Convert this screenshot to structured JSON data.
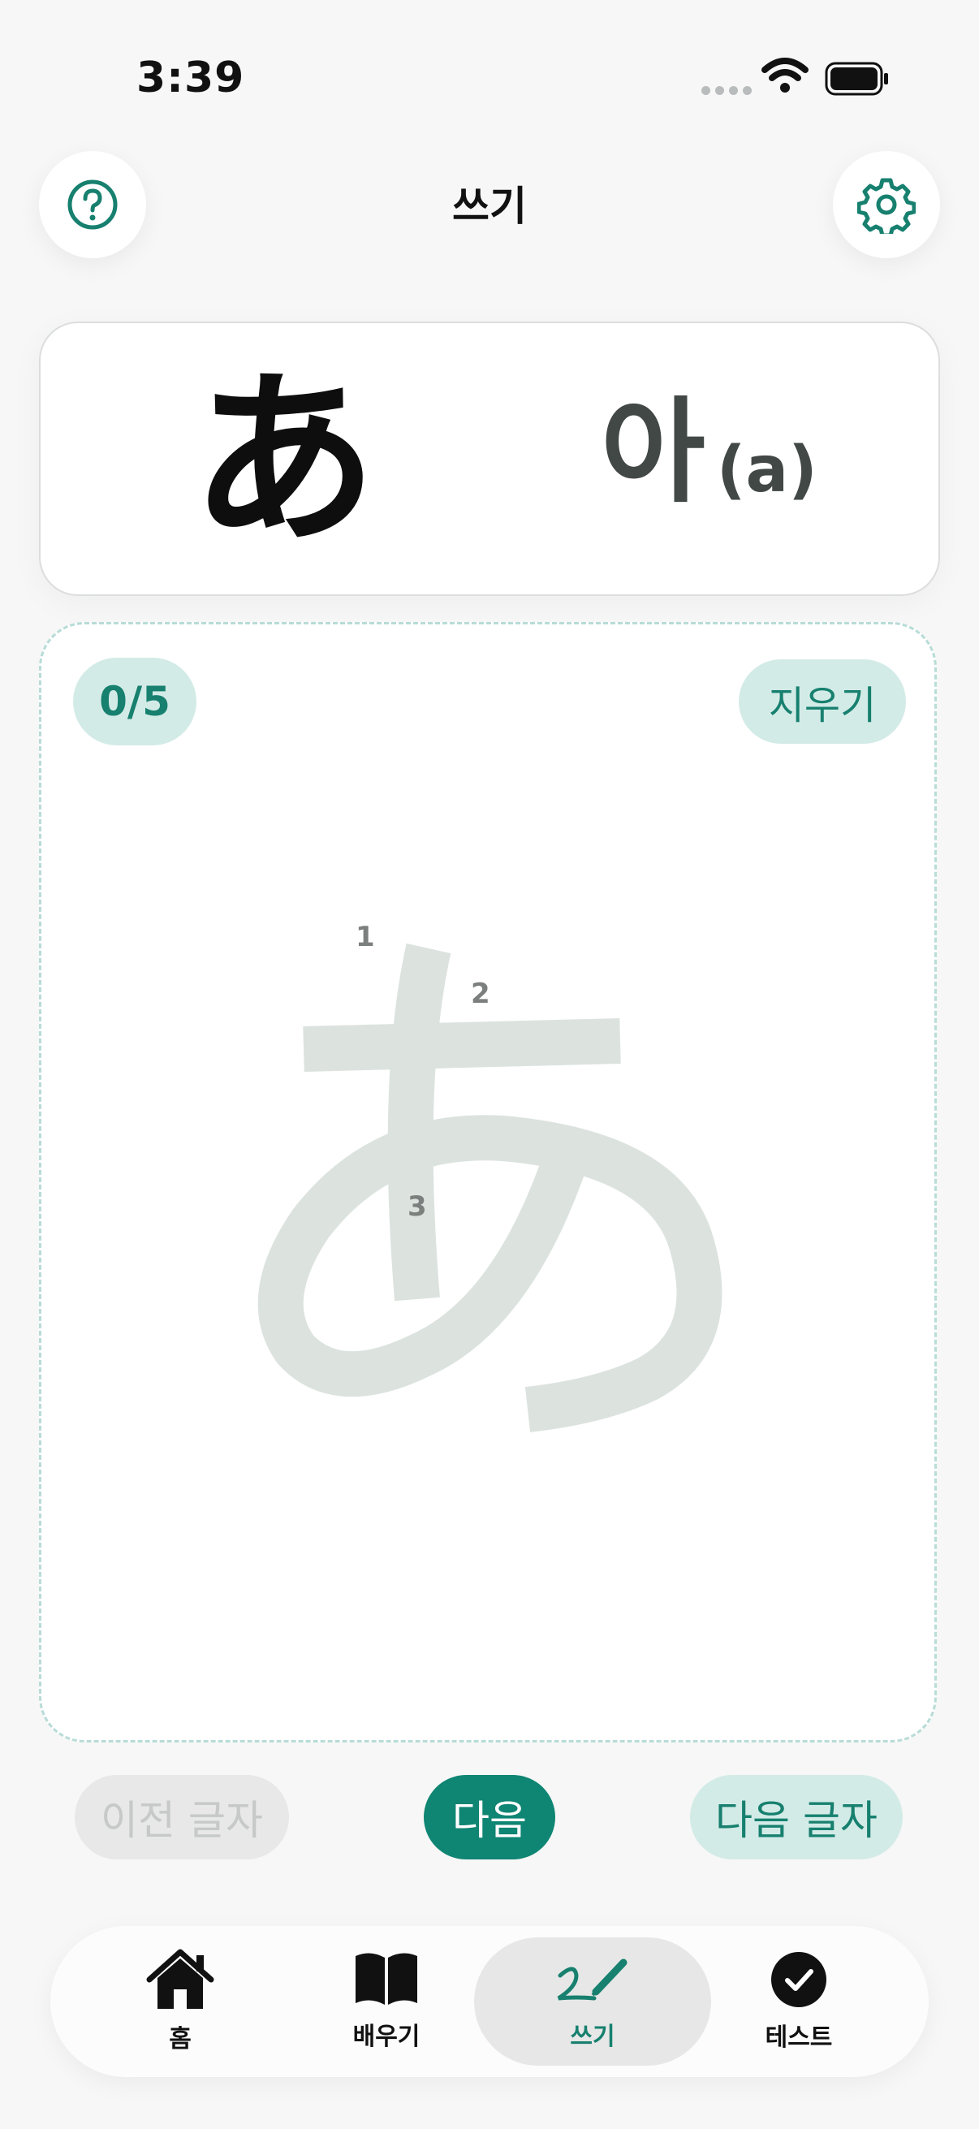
{
  "status_bar": {
    "time": "3:39"
  },
  "header": {
    "title": "쓰기",
    "help_icon": "question-circle-icon",
    "settings_icon": "gear-icon"
  },
  "card": {
    "kana": "あ",
    "reading": "아",
    "romaji": "(a)"
  },
  "practice": {
    "progress": "0/5",
    "clear_label": "지우기",
    "guide_character": "あ",
    "stroke_numbers": [
      "1",
      "2",
      "3"
    ]
  },
  "actions": {
    "prev_label": "이전 글자",
    "next_label": "다음",
    "next_char_label": "다음 글자"
  },
  "tabs": [
    {
      "label": "홈",
      "icon": "house-icon",
      "active": false
    },
    {
      "label": "배우기",
      "icon": "book-icon",
      "active": false
    },
    {
      "label": "쓰기",
      "icon": "pen-icon",
      "active": true
    },
    {
      "label": "테스트",
      "icon": "check-circle-icon",
      "active": false
    }
  ],
  "colors": {
    "accent": "#0f8573",
    "accent_light": "#d3ebe7",
    "guide_stroke": "#dce3df",
    "background": "#f6f7f6"
  }
}
